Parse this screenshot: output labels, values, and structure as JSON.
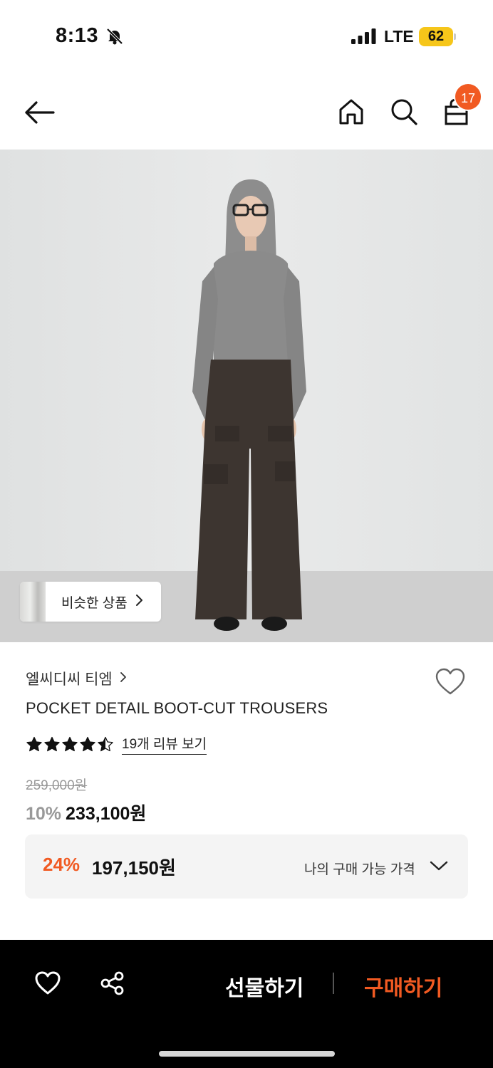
{
  "status": {
    "time": "8:13",
    "network": "LTE",
    "battery": "62"
  },
  "nav": {
    "cart_count": "17",
    "icons": [
      "back-arrow-icon",
      "home-icon",
      "search-icon",
      "shopping-bag-icon"
    ]
  },
  "hero": {
    "similar_label": "비슷한 상품"
  },
  "product": {
    "brand": "엘씨디씨 티엠",
    "title": "POCKET DETAIL BOOT-CUT TROUSERS",
    "rating": 4.5,
    "review_link": "19개 리뷰 보기",
    "original_price": "259,000원",
    "discount_rate": "10%",
    "price": "233,100원"
  },
  "my_price": {
    "discount_rate": "24%",
    "price": "197,150원",
    "label": "나의 구매 가능 가격"
  },
  "bottom_bar": {
    "gift_label": "선물하기",
    "buy_label": "구매하기"
  },
  "colors": {
    "accent": "#f15a22",
    "bottom_bar_bg": "#000000",
    "box_bg": "#f4f4f4"
  }
}
